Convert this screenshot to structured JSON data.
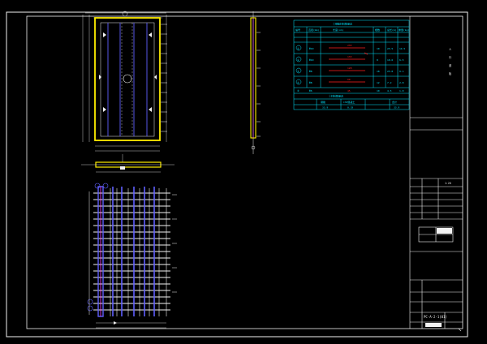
{
  "viewport": {
    "background": "#000000",
    "sheet_color": "#ffffff"
  },
  "colors": {
    "yellow": "#ffee00",
    "cyan": "#00e5ff",
    "magenta": "#ff40ff",
    "blue": "#6060ff",
    "red": "#ff2020",
    "white": "#f2f2f2",
    "green": "#30ff30"
  },
  "title_block": {
    "drawing_title": "PC-A-2-1(01)",
    "vertical_title": [
      "人",
      "行",
      "道",
      "板"
    ],
    "scale_label": "1:20"
  },
  "rebar_table": {
    "title": "ⓒ钢筋材料数量表",
    "header": [
      "编号",
      "直径(mm)",
      "长度(cm)",
      "根数",
      "总长(m)",
      "重量(kg)"
    ],
    "rows": [
      [
        "①",
        "Φ10",
        "235",
        "10",
        "23.5",
        "14.5"
      ],
      [
        "②",
        "Φ10",
        "133",
        "8",
        "10.6",
        "6.5"
      ],
      [
        "③",
        "Φ8",
        "128",
        "18",
        "23.0",
        "9.1"
      ],
      [
        "④",
        "Φ8",
        "60",
        "12",
        "7.2",
        "2.8"
      ],
      [
        "⑤",
        "Φ6",
        "45",
        "10",
        "4.5",
        "1.0"
      ]
    ],
    "summary_title": "ⓒ材料数量表",
    "summary_header": [
      "钢筋",
      "C30混凝土",
      "合计"
    ],
    "summary_row": [
      "33.9",
      "0.19",
      "33.9"
    ]
  }
}
